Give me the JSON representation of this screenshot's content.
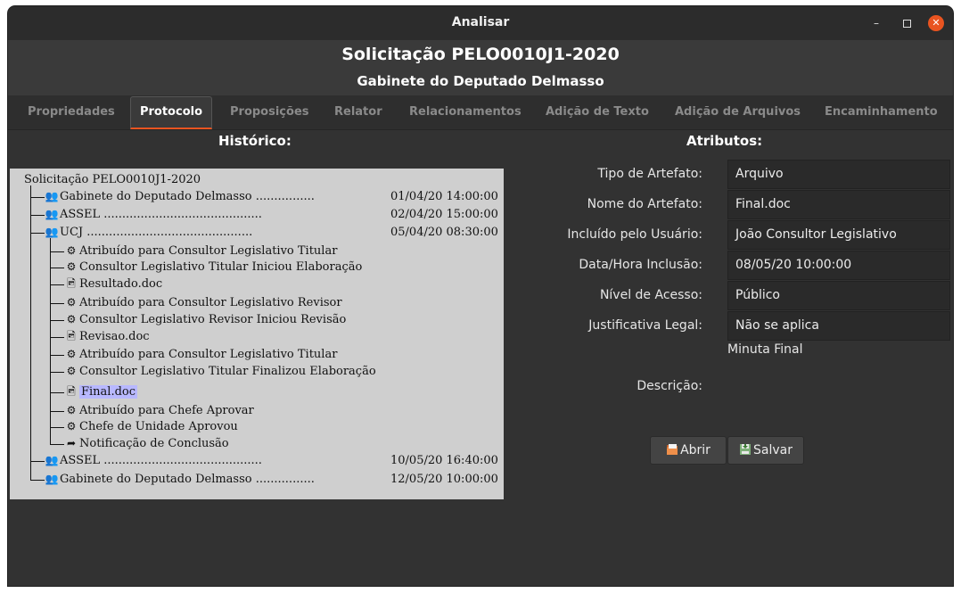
{
  "window": {
    "title": "Analisar"
  },
  "header": {
    "title": "Solicitação PELO0010J1-2020",
    "subtitle": "Gabinete do Deputado Delmasso"
  },
  "tabs": [
    {
      "label": "Propriedades"
    },
    {
      "label": "Protocolo"
    },
    {
      "label": "Proposições"
    },
    {
      "label": "Relator"
    },
    {
      "label": "Relacionamentos"
    },
    {
      "label": "Adição de Texto"
    },
    {
      "label": "Adição de Arquivos"
    },
    {
      "label": "Encaminhamento"
    }
  ],
  "active_tab": "Protocolo",
  "history": {
    "title": "Histórico:",
    "root": "Solicitação PELO0010J1-2020",
    "nodes": [
      {
        "icon": "group-icon",
        "label": "Gabinete do Deputado Delmasso",
        "leader": " ................",
        "time": "01/04/20 14:00:00"
      },
      {
        "icon": "group-icon",
        "label": "ASSEL",
        "leader": " ...........................................",
        "time": "02/04/20 15:00:00"
      },
      {
        "icon": "group-icon",
        "label": "UCJ",
        "leader": " .............................................",
        "time": "05/04/20 08:30:00"
      },
      {
        "icon": "gears-icon",
        "label": "Atribuído para Consultor Legislativo Titular"
      },
      {
        "icon": "gears-icon",
        "label": "Consultor Legislativo Titular Iniciou Elaboração"
      },
      {
        "icon": "file-image-icon",
        "label": "Resultado.doc"
      },
      {
        "icon": "gears-icon",
        "label": "Atribuído para Consultor Legislativo Revisor"
      },
      {
        "icon": "gears-icon",
        "label": "Consultor Legislativo Revisor Iniciou Revisão"
      },
      {
        "icon": "file-image-icon",
        "label": "Revisao.doc"
      },
      {
        "icon": "gears-icon",
        "label": "Atribuído para Consultor Legislativo Titular"
      },
      {
        "icon": "gears-icon",
        "label": "Consultor Legislativo Titular Finalizou Elaboração"
      },
      {
        "icon": "file-image-icon",
        "label": "Final.doc",
        "selected": true
      },
      {
        "icon": "gears-icon",
        "label": "Atribuído para Chefe Aprovar"
      },
      {
        "icon": "gears-icon",
        "label": "Chefe de Unidade Aprovou"
      },
      {
        "icon": "share-arrow-icon",
        "label": "Notificação de Conclusão"
      },
      {
        "icon": "group-icon",
        "label": "ASSEL",
        "leader": " ...........................................",
        "time": "10/05/20 16:40:00"
      },
      {
        "icon": "group-icon",
        "label": "Gabinete do Deputado Delmasso",
        "leader": " ................",
        "time": "12/05/20 10:00:00"
      }
    ]
  },
  "attributes": {
    "title": "Atributos:",
    "fields": [
      {
        "label": "Tipo de Artefato:",
        "value": "Arquivo"
      },
      {
        "label": "Nome do Artefato:",
        "value": "Final.doc"
      },
      {
        "label": "Incluído pelo Usuário:",
        "value": "João Consultor Legislativo"
      },
      {
        "label": "Data/Hora Inclusão:",
        "value": "08/05/20 10:00:00"
      },
      {
        "label": "Nível de Acesso:",
        "value": "Público"
      },
      {
        "label": "Justificativa Legal:",
        "value": "Não se aplica"
      }
    ],
    "note": "Minuta Final",
    "description_label": "Descrição:",
    "buttons": {
      "open": "Abrir",
      "save": "Salvar"
    }
  },
  "colors": {
    "accent": "#e95420",
    "selection": "#b8b8ff",
    "tree_bg": "#cfcfcf"
  }
}
